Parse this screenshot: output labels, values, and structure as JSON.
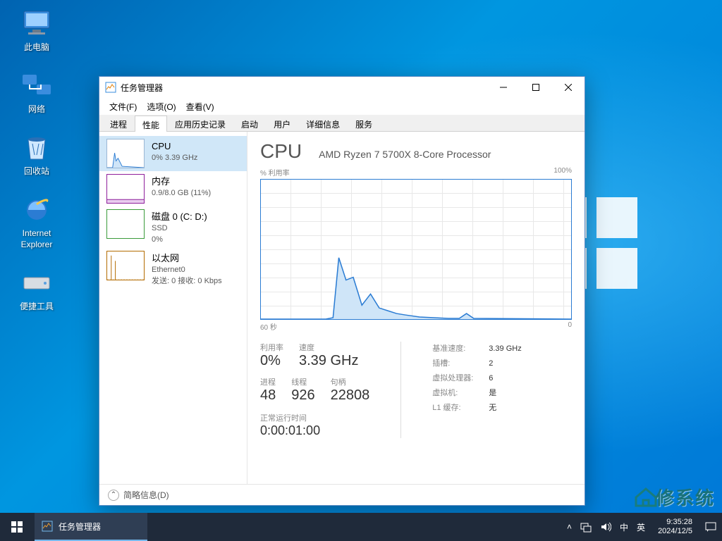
{
  "desktop": {
    "icons": [
      {
        "name": "此电脑"
      },
      {
        "name": "网络"
      },
      {
        "name": "回收站"
      },
      {
        "name": "Internet Explorer"
      },
      {
        "name": "便捷工具"
      }
    ]
  },
  "window": {
    "title": "任务管理器",
    "menu": {
      "file": "文件(F)",
      "options": "选项(O)",
      "view": "查看(V)"
    },
    "tabs": [
      "进程",
      "性能",
      "应用历史记录",
      "启动",
      "用户",
      "详细信息",
      "服务"
    ],
    "active_tab": "性能",
    "footer": "简略信息(D)"
  },
  "sidebar": [
    {
      "name": "CPU",
      "line2": "0% 3.39 GHz",
      "color": "#2b7cd3",
      "selected": true
    },
    {
      "name": "内存",
      "line2": "0.9/8.0 GB (11%)",
      "color": "#8e1e9b"
    },
    {
      "name": "磁盘 0 (C: D:)",
      "line2": "SSD",
      "line3": "0%",
      "color": "#3a9b3a"
    },
    {
      "name": "以太网",
      "line2": "Ethernet0",
      "line3": "发送: 0 接收: 0 Kbps",
      "color": "#b36b00"
    }
  ],
  "detail": {
    "title": "CPU",
    "subtitle": "AMD Ryzen 7 5700X 8-Core Processor",
    "ylabel": "% 利用率",
    "ymax": "100%",
    "xlabel_left": "60 秒",
    "xlabel_right": "0",
    "stats_row1": [
      {
        "k": "利用率",
        "v": "0%"
      },
      {
        "k": "速度",
        "v": "3.39 GHz"
      }
    ],
    "stats_row2": [
      {
        "k": "进程",
        "v": "48"
      },
      {
        "k": "线程",
        "v": "926"
      },
      {
        "k": "句柄",
        "v": "22808"
      }
    ],
    "specs": [
      {
        "k": "基准速度:",
        "v": "3.39 GHz"
      },
      {
        "k": "插槽:",
        "v": "2"
      },
      {
        "k": "虚拟处理器:",
        "v": "6"
      },
      {
        "k": "虚拟机:",
        "v": "是"
      },
      {
        "k": "L1 缓存:",
        "v": "无"
      }
    ],
    "uptime": {
      "k": "正常运行时间",
      "v": "0:00:01:00"
    }
  },
  "chart_data": {
    "type": "area",
    "title": "CPU % 利用率",
    "xlabel": "秒",
    "ylabel": "% 利用率",
    "ylim": [
      0,
      100
    ],
    "xlim_seconds": [
      60,
      0
    ],
    "x": [
      60,
      57,
      54,
      51,
      48,
      45,
      42,
      40,
      39,
      38,
      36,
      34,
      32,
      30,
      28,
      26,
      24,
      22,
      20,
      18,
      16,
      14,
      12,
      10,
      8,
      6,
      4,
      2,
      0
    ],
    "values": [
      0,
      0,
      0,
      0,
      0,
      0,
      0,
      2,
      44,
      28,
      30,
      10,
      18,
      8,
      6,
      4,
      3,
      2,
      1,
      1,
      0,
      0,
      4,
      1,
      0,
      0,
      0,
      0,
      0
    ]
  },
  "taskbar": {
    "app": "任务管理器",
    "ime_lang": "中",
    "ime_mode": "英",
    "time": "9:35:28",
    "date": "2024/12/5"
  },
  "watermark": "修系统"
}
